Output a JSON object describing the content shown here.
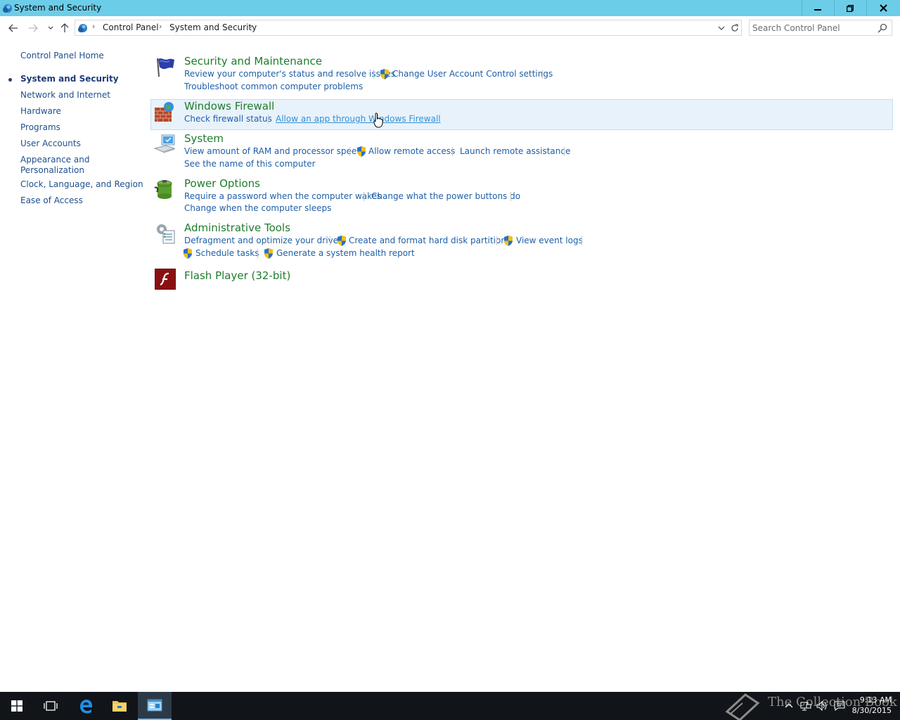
{
  "window": {
    "title": "System and Security",
    "minimize_icon": "minimize-icon",
    "maximize_icon": "restore-icon",
    "close_icon": "close-icon"
  },
  "address_bar": {
    "breadcrumbs": [
      "Control Panel",
      "System and Security"
    ],
    "search_placeholder": "Search Control Panel"
  },
  "sidebar": {
    "home": "Control Panel Home",
    "items": [
      {
        "label": "System and Security",
        "current": true
      },
      {
        "label": "Network and Internet"
      },
      {
        "label": "Hardware"
      },
      {
        "label": "Programs"
      },
      {
        "label": "User Accounts"
      },
      {
        "label": "Appearance and Personalization"
      },
      {
        "label": "Clock, Language, and Region"
      },
      {
        "label": "Ease of Access"
      }
    ]
  },
  "categories": [
    {
      "title": "Security and Maintenance",
      "icon": "flag-icon",
      "tasks": [
        "Review your computer's status and resolve issues",
        "Change User Account Control settings",
        "Troubleshoot common computer problems"
      ]
    },
    {
      "title": "Windows Firewall",
      "icon": "firewall-icon",
      "tasks": [
        "Check firewall status",
        "Allow an app through Windows Firewall"
      ]
    },
    {
      "title": "System",
      "icon": "computer-icon",
      "tasks": [
        "View amount of RAM and processor speed",
        "Allow remote access",
        "Launch remote assistance",
        "See the name of this computer"
      ]
    },
    {
      "title": "Power Options",
      "icon": "battery-icon",
      "tasks": [
        "Require a password when the computer wakes",
        "Change what the power buttons do",
        "Change when the computer sleeps"
      ]
    },
    {
      "title": "Administrative Tools",
      "icon": "admin-tools-icon",
      "tasks": [
        "Defragment and optimize your drives",
        "Create and format hard disk partitions",
        "View event logs",
        "Schedule tasks",
        "Generate a system health report"
      ]
    },
    {
      "title": "Flash Player (32-bit)",
      "icon": "flash-icon",
      "tasks": []
    }
  ],
  "taskbar": {
    "watermark": "The Collection Book",
    "time": "9:13 AM",
    "date": "8/30/2015"
  },
  "colors": {
    "titlebar": "#6ccde8",
    "category_title": "#1e7d2c",
    "link": "#1e5fa8",
    "hover_bg": "#e8f2fb"
  }
}
